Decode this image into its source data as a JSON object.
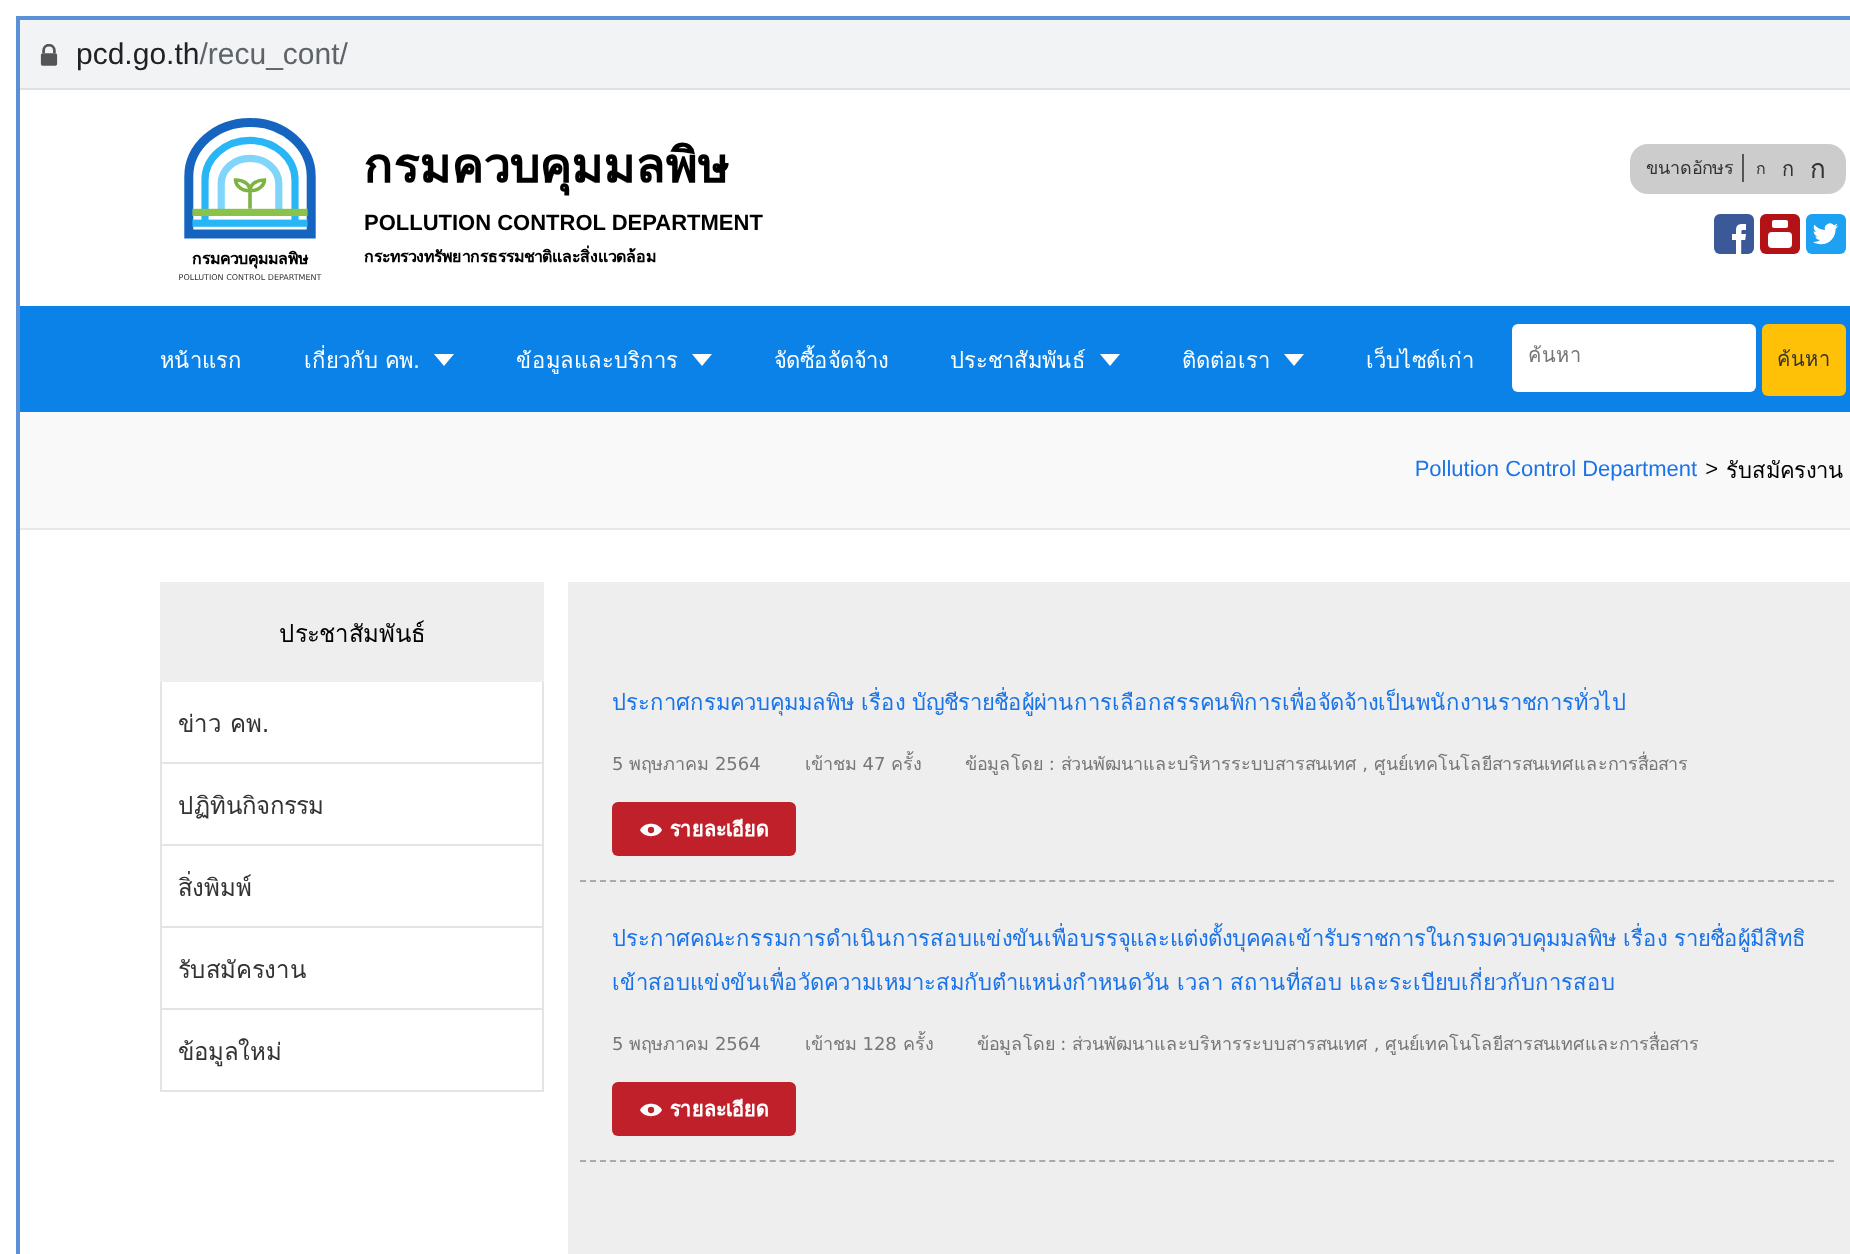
{
  "address_bar": {
    "domain": "pcd.go.th",
    "path": "/recu_cont/"
  },
  "header": {
    "logo_caption": "กรมควบคุมมลพิษ",
    "logo_caption_en": "POLLUTION CONTROL DEPARTMENT",
    "title": "กรมควบคุมมลพิษ",
    "subtitle": "POLLUTION CONTROL DEPARTMENT",
    "ministry": "กระทรวงทรัพยากรธรรมชาติและสิ่งแวดล้อม",
    "font_size": {
      "label": "ขนาดอักษร",
      "sizes": [
        "ก",
        "ก",
        "ก"
      ]
    }
  },
  "nav": {
    "items": [
      {
        "label": "หน้าแรก",
        "has_dropdown": false
      },
      {
        "label": "เกี่ยวกับ คพ.",
        "has_dropdown": true
      },
      {
        "label": "ข้อมูลและบริการ",
        "has_dropdown": true
      },
      {
        "label": "จัดซื้อจัดจ้าง",
        "has_dropdown": false
      },
      {
        "label": "ประชาสัมพันธ์",
        "has_dropdown": true
      },
      {
        "label": "ติดต่อเรา",
        "has_dropdown": true
      },
      {
        "label": "เว็บไซต์เก่า",
        "has_dropdown": false
      }
    ],
    "search": {
      "placeholder": "ค้นหา",
      "button": "ค้นหา"
    }
  },
  "breadcrumb": {
    "link": "Pollution Control Department",
    "separator": ">",
    "current": "รับสมัครงาน"
  },
  "sidebar": {
    "heading": "ประชาสัมพันธ์",
    "items": [
      "ข่าว คพ.",
      "ปฏิทินกิจกรรม",
      "สิ่งพิมพ์",
      "รับสมัครงาน",
      "ข้อมูลใหม่"
    ]
  },
  "posts": [
    {
      "title": "ประกาศกรมควบคุมมลพิษ เรื่อง บัญชีรายชื่อผู้ผ่านการเลือกสรรคนพิการเพื่อจัดจ้างเป็นพนักงานราชการทั่วไป",
      "date": "5 พฤษภาคม 2564",
      "views": "เข้าชม 47 ครั้ง",
      "source": "ข้อมูลโดย : ส่วนพัฒนาและบริหารระบบสารสนเทศ , ศูนย์เทคโนโลยีสารสนเทศและการสื่อสาร",
      "button": "รายละเอียด"
    },
    {
      "title": "ประกาศคณะกรรมการดำเนินการสอบแข่งขันเพื่อบรรจุและแต่งตั้งบุคคลเข้ารับราชการในกรมควบคุมมลพิษ เรื่อง รายชื่อผู้มีสิทธิเข้าสอบแข่งขันเพื่อวัดความเหมาะสมกับตำแหน่งกำหนดวัน เวลา สถานที่สอบ และระเบียบเกี่ยวกับการสอบ",
      "date": "5 พฤษภาคม 2564",
      "views": "เข้าชม 128 ครั้ง",
      "source": "ข้อมูลโดย : ส่วนพัฒนาและบริหารระบบสารสนเทศ , ศูนย์เทคโนโลยีสารสนเทศและการสื่อสาร",
      "button": "รายละเอียด"
    }
  ]
}
